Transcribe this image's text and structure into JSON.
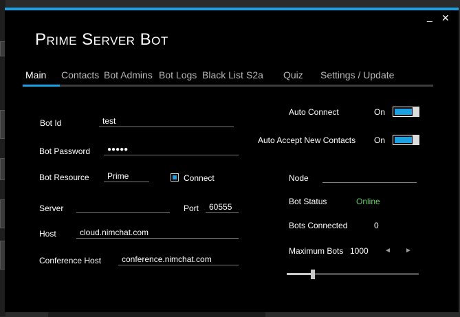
{
  "window": {
    "title": "Prime Server Bot",
    "minimize_glyph": "_",
    "close_glyph": "✕",
    "accent_color": "#1ba1e2"
  },
  "tabs": [
    {
      "label": "Main",
      "active": true
    },
    {
      "label": "Contacts"
    },
    {
      "label": "Bot Admins"
    },
    {
      "label": "Bot Logs"
    },
    {
      "label": "Black List"
    },
    {
      "label": "S2a"
    },
    {
      "label": "Quiz"
    },
    {
      "label": "Settings / Update"
    }
  ],
  "left": {
    "bot_id_label": "Bot Id",
    "bot_id_value": "test",
    "bot_password_label": "Bot Password",
    "bot_password_value": "●●●●●",
    "bot_resource_label": "Bot Resource",
    "bot_resource_value": "Prime",
    "connect_label": "Connect",
    "connect_checked": true,
    "server_label": "Server",
    "server_value": "",
    "port_label": "Port",
    "port_value": "60555",
    "host_label": "Host",
    "host_value": "cloud.nimchat.com",
    "conference_host_label": "Conference Host",
    "conference_host_value": "conference.nimchat.com"
  },
  "right": {
    "auto_connect_label": "Auto Connect",
    "auto_connect_state": "On",
    "auto_accept_label": "Auto Accept New Contacts",
    "auto_accept_state": "On",
    "node_label": "Node",
    "node_value": "",
    "bot_status_label": "Bot Status",
    "bot_status_value": "Online",
    "bot_status_color": "#66cc66",
    "bots_connected_label": "Bots Connected",
    "bots_connected_value": "0",
    "max_bots_label": "Maximum Bots",
    "max_bots_value": "1000",
    "prev_glyph": "◄",
    "next_glyph": "►",
    "slider_fraction": 0.2
  }
}
